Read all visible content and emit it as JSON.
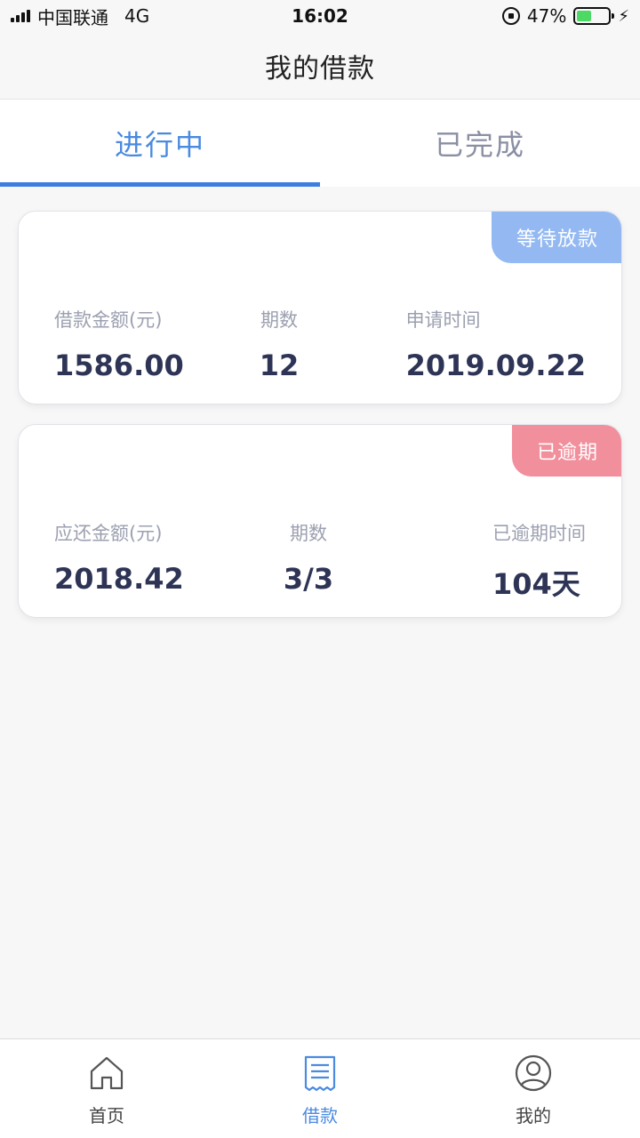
{
  "status_bar": {
    "carrier": "中国联通",
    "network": "4G",
    "time": "16:02",
    "battery_percent": "47%",
    "battery_level": 0.47
  },
  "nav": {
    "title": "我的借款"
  },
  "tabs": [
    {
      "label": "进行中",
      "active": true
    },
    {
      "label": "已完成",
      "active": false
    }
  ],
  "cards": [
    {
      "badge": "等待放款",
      "badge_color": "#94b9f2",
      "col1_label": "借款金额(元)",
      "col1_value": "1586.00",
      "col2_label": "期数",
      "col2_value": "12",
      "col3_label": "申请时间",
      "col3_value": "2019.09.22"
    },
    {
      "badge": "已逾期",
      "badge_color": "#f28f9c",
      "col1_label": "应还金额(元)",
      "col1_value": "2018.42",
      "col2_label": "期数",
      "col2_value": "3/3",
      "col3_label": "已逾期时间",
      "col3_value": "104天"
    }
  ],
  "bottom_nav": [
    {
      "label": "首页",
      "icon": "home-icon",
      "active": false
    },
    {
      "label": "借款",
      "icon": "receipt-icon",
      "active": true
    },
    {
      "label": "我的",
      "icon": "profile-icon",
      "active": false
    }
  ],
  "colors": {
    "accent": "#4a8ae0",
    "text_primary": "#2e3455",
    "text_secondary": "#9ca0b0"
  }
}
